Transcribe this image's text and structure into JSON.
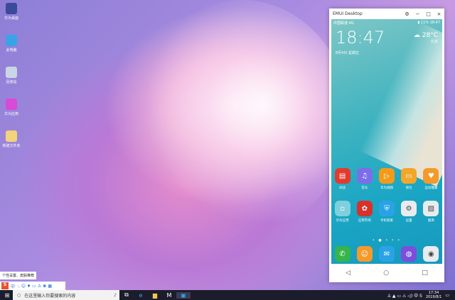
{
  "desktop": {
    "icons": [
      {
        "label": "华为桌面",
        "color": "#3b4a9a"
      },
      {
        "label": "此电脑",
        "color": "#3aa3e8"
      },
      {
        "label": "回收站",
        "color": "#c9d6e3"
      },
      {
        "label": "华为应用",
        "color": "#d94ad6"
      },
      {
        "label": "新建文件夹",
        "color": "#f2d27a"
      }
    ]
  },
  "window": {
    "title": "EMUI Desktop",
    "settings_icon": "gear-icon",
    "minimize": "−",
    "maximize": "□",
    "close": "×"
  },
  "phone": {
    "carrier": "中国联通 4G",
    "status_right": "▮ 11% 18:47",
    "time": "18:47",
    "date": "8月4日 星期五",
    "weather_temp": "28°C",
    "weather_sub": "北京",
    "apps_row1": [
      {
        "label": "阅读",
        "color": "#e23b2e",
        "glyph": "▤"
      },
      {
        "label": "音乐",
        "color": "#7b6ee8",
        "glyph": "♫"
      },
      {
        "label": "华为视频",
        "color": "#f49a1a",
        "glyph": "▷"
      },
      {
        "label": "钱包",
        "color": "#f2a62a",
        "glyph": "▭"
      },
      {
        "label": "运动健康",
        "color": "#f39a2a",
        "glyph": "♥"
      }
    ],
    "apps_row2": [
      {
        "label": "华为应用",
        "color": "#7fd0dd",
        "glyph": "▫"
      },
      {
        "label": "应用市场",
        "color": "#d9302a",
        "glyph": "✿"
      },
      {
        "label": "手机管家",
        "color": "#2aa3e6",
        "glyph": "⛨"
      },
      {
        "label": "设置",
        "color": "#e9ecef",
        "glyph": "⚙"
      },
      {
        "label": "图库",
        "color": "#e9ecef",
        "glyph": "▨"
      }
    ],
    "page_dots": "• ● • • •",
    "dock": [
      {
        "label": "电话",
        "color": "#35b54a",
        "glyph": "✆"
      },
      {
        "label": "联系人",
        "color": "#f59a2a",
        "glyph": "☺"
      },
      {
        "label": "信息",
        "color": "#2aa3e6",
        "glyph": "✉"
      },
      {
        "label": "浏览器",
        "color": "#7a4fdc",
        "glyph": "◍"
      },
      {
        "label": "相机",
        "color": "#e9ecef",
        "glyph": "◉"
      }
    ],
    "nav": {
      "back": "◁",
      "home": "○",
      "recent": "□"
    }
  },
  "tooltip": "个性设置、皮肤推荐",
  "ime": {
    "logo": "S",
    "mode": "中",
    "icons": "·, ☺ ♦ ▭ ♙ ♚ ▦"
  },
  "taskbar": {
    "start": "⊞",
    "search_placeholder": "在这里输入你要搜索的内容",
    "mic": "🎙",
    "task_view": "⧉",
    "apps": [
      "e",
      "▆",
      "M",
      "▣"
    ],
    "tray_icons": "♙ ▲ ▭ ⚠ ◁) 中 S",
    "time": "17:34",
    "date": "2019/8/1",
    "notify": "▭"
  }
}
